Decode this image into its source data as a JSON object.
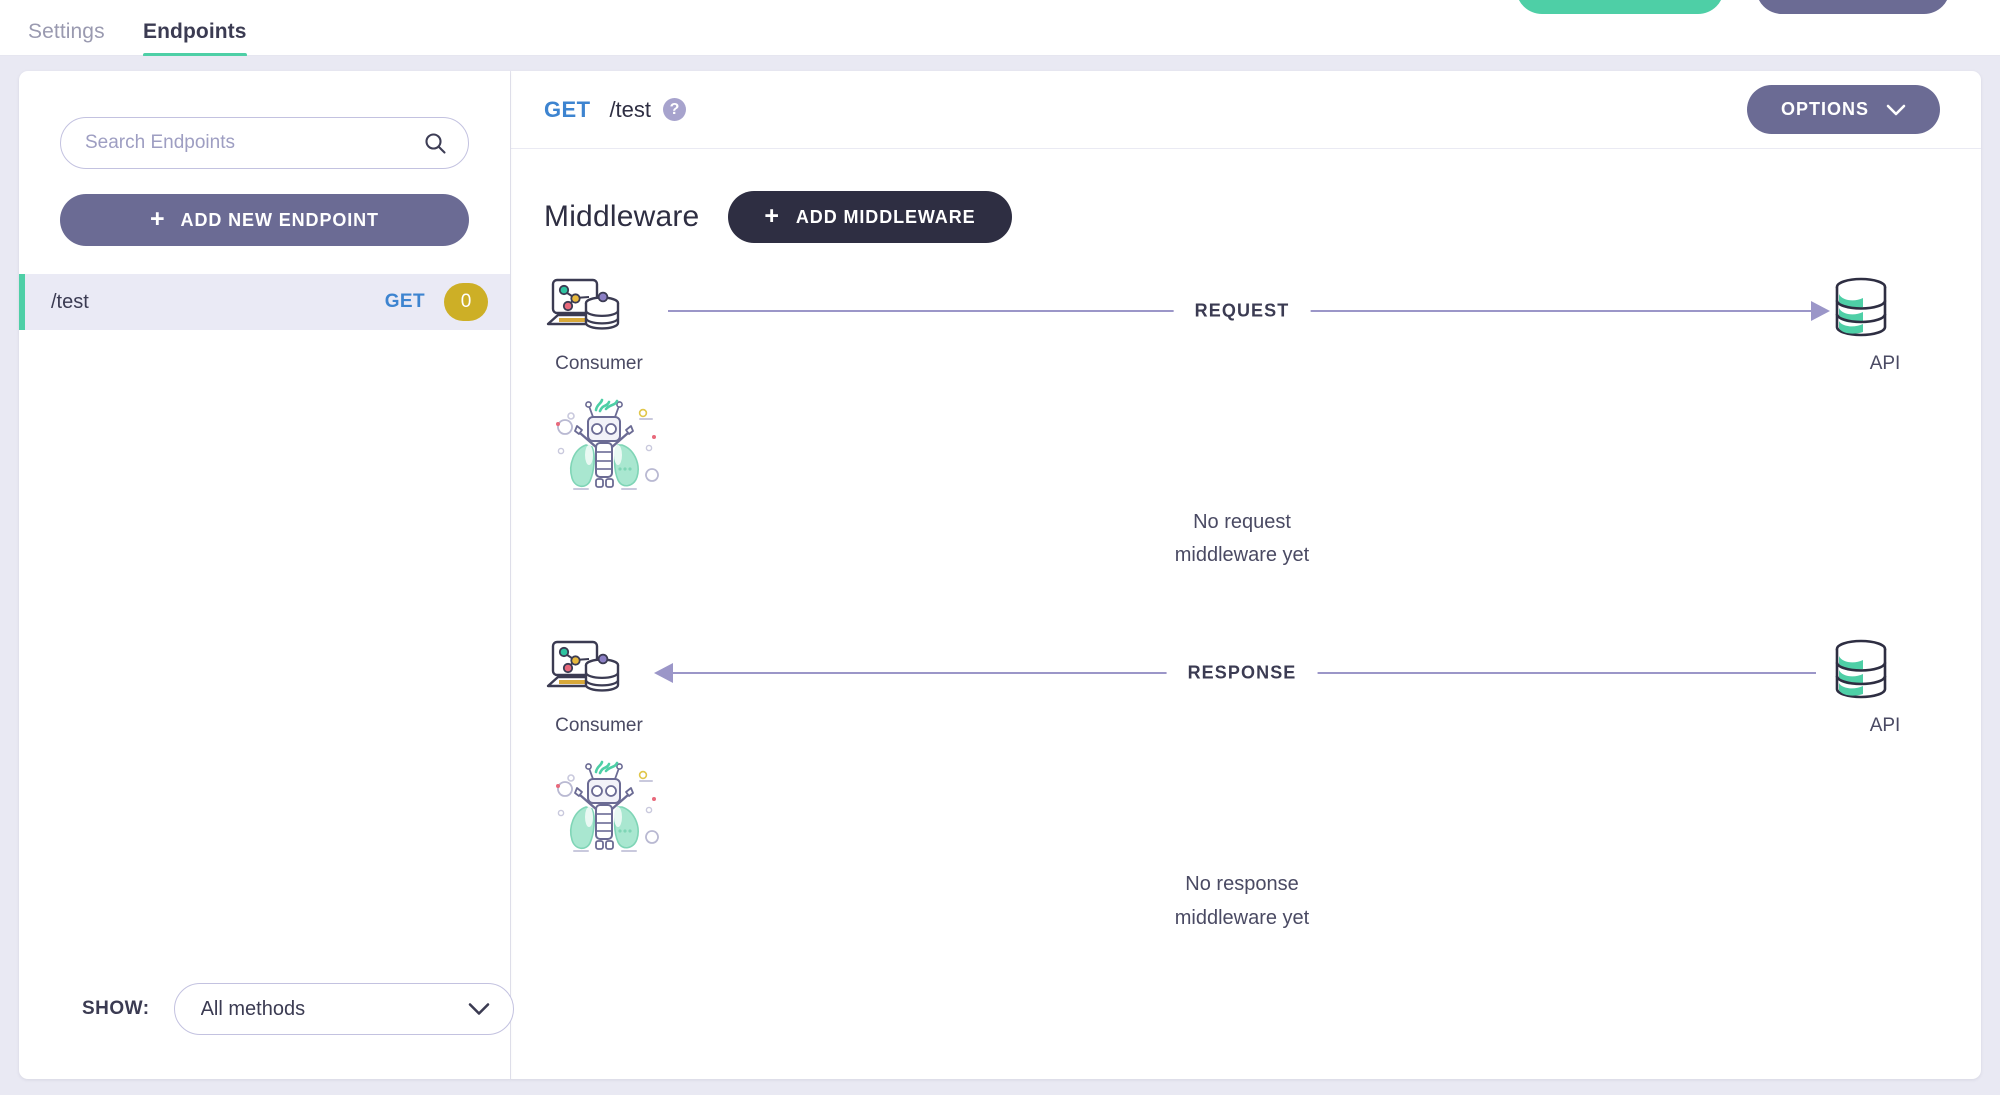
{
  "tabs": [
    {
      "label": "Settings",
      "active": false
    },
    {
      "label": "Endpoints",
      "active": true
    }
  ],
  "colors": {
    "accent_teal": "#4ecfa6",
    "accent_purple": "#6b6b94",
    "dark": "#2e2e42",
    "method_blue": "#3d84d0",
    "badge_gold": "#cdaf26",
    "page_bg": "#e9e9f3",
    "line": "#9b96c8"
  },
  "sidebar": {
    "search": {
      "placeholder": "Search Endpoints",
      "value": "",
      "icon": "search-icon"
    },
    "add_endpoint_button": {
      "label": "ADD NEW ENDPOINT",
      "icon": "plus-icon"
    },
    "endpoints": [
      {
        "path": "/test",
        "method": "GET",
        "count": "0"
      }
    ],
    "footer": {
      "show_label": "SHOW:",
      "selected_method": "All methods",
      "method_options": [
        "All methods"
      ]
    }
  },
  "main": {
    "header": {
      "method": "GET",
      "path": "/test",
      "help_icon": "?",
      "options_button": {
        "label": "OPTIONS",
        "icon": "chevron-down-icon"
      }
    },
    "middleware": {
      "title": "Middleware",
      "add_button": {
        "label": "ADD MIDDLEWARE",
        "icon": "plus-icon"
      }
    },
    "flows": [
      {
        "direction": "request",
        "label": "REQUEST",
        "left_node": "Consumer",
        "right_node": "API",
        "empty_line1": "No request",
        "empty_line2": "middleware yet"
      },
      {
        "direction": "response",
        "label": "RESPONSE",
        "left_node": "Consumer",
        "right_node": "API",
        "empty_line1": "No response",
        "empty_line2": "middleware yet"
      }
    ]
  }
}
